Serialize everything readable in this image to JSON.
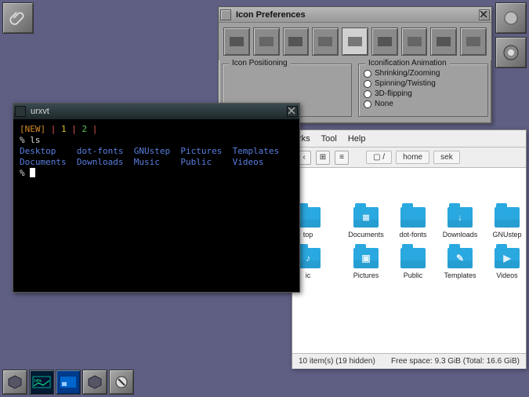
{
  "desktop": {
    "clip_icon": "paperclip-icon",
    "top_right_icons": [
      "planet-icon",
      "gnustep-icon"
    ]
  },
  "icon_prefs": {
    "title": "Icon Preferences",
    "tools": [
      "tool-icon",
      "tool-icon",
      "tool-icon",
      "tool-icon",
      "tool-icon",
      "tool-icon",
      "tool-icon",
      "tool-icon",
      "tool-icon",
      "tool-icon"
    ],
    "group_positioning_label": "Icon Positioning",
    "group_anim_label": "Iconification Animation",
    "anim_options": [
      "Shrinking/Zooming",
      "Spinning/Twisting",
      "3D-flipping",
      "None"
    ]
  },
  "file_manager": {
    "menus_visible": [
      "rks",
      "Tool",
      "Help"
    ],
    "path": {
      "root_icon": "drive-icon",
      "sep": "/",
      "segments": [
        "home",
        "sek"
      ]
    },
    "folders": [
      {
        "name": "top",
        "partial": true,
        "glyph": ""
      },
      {
        "name": "Documents",
        "glyph": "≣"
      },
      {
        "name": "dot-fonts",
        "glyph": ""
      },
      {
        "name": "Downloads",
        "glyph": "↓"
      },
      {
        "name": "GNUstep",
        "glyph": ""
      },
      {
        "name": "ic",
        "partial": true,
        "glyph": "♪"
      },
      {
        "name": "Pictures",
        "glyph": "▣"
      },
      {
        "name": "Public",
        "glyph": ""
      },
      {
        "name": "Templates",
        "glyph": "✎"
      },
      {
        "name": "Videos",
        "glyph": "▶"
      }
    ],
    "status_left": "10 item(s) (19 hidden)",
    "status_right": "Free space: 9.3 GiB (Total: 16.6 GiB)"
  },
  "terminal": {
    "title": "urxvt",
    "line1": {
      "new": "[NEW]",
      "sep": "|",
      "n1": "1",
      "n2": "2"
    },
    "prompt": "%",
    "cmd": "ls",
    "listing_row1": [
      "Desktop",
      "dot-fonts",
      "GNUstep",
      "Pictures",
      "Templates"
    ],
    "listing_row2": [
      "Documents",
      "Downloads",
      "Music",
      "Public",
      "Videos"
    ]
  },
  "bottom_dock": [
    "cube-icon",
    "monitor-icon",
    "pager-icon",
    "cube-icon",
    "prefs-icon"
  ]
}
